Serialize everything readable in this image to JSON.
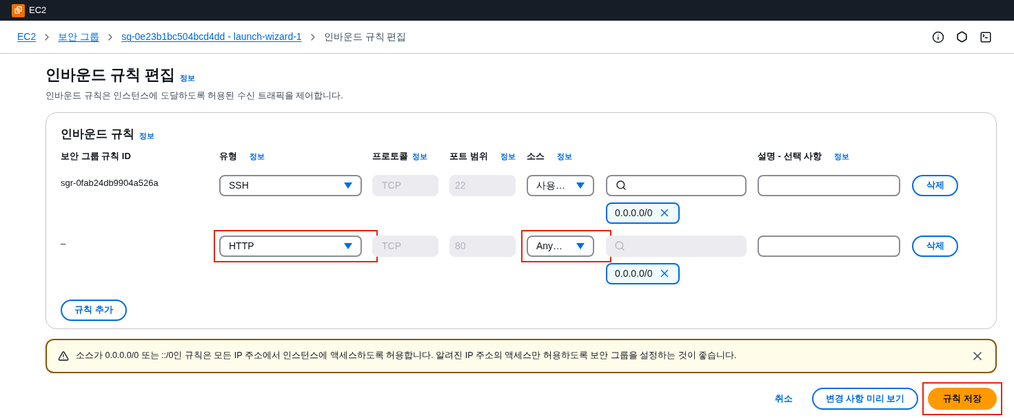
{
  "app": {
    "name": "EC2"
  },
  "breadcrumbs": [
    {
      "label": "EC2",
      "link": true
    },
    {
      "label": "보안 그룹",
      "link": true
    },
    {
      "label": "sg-0e23b1bc504bcd4dd - launch-wizard-1",
      "link": true
    },
    {
      "label": "인바운드 규칙 편집",
      "link": false
    }
  ],
  "page": {
    "title": "인바운드 규칙 편집",
    "info": "정보",
    "description": "인바운드 규칙은 인스턴스에 도달하도록 허용된 수신 트래픽을 제어합니다."
  },
  "panel": {
    "title": "인바운드 규칙",
    "info": "정보",
    "columns": [
      {
        "label": "보안 그룹 규칙 ID"
      },
      {
        "label": "유형",
        "info": "정보"
      },
      {
        "label": "프로토콜",
        "info": "정보"
      },
      {
        "label": "포트 범위",
        "info": "정보"
      },
      {
        "label": "소스",
        "info": "정보"
      },
      {
        "label": "설명 - 선택 사항",
        "info": "정보"
      }
    ],
    "rules": [
      {
        "id": "sgr-0fab24db9904a526a",
        "type": {
          "value": "SSH",
          "highlighted": false
        },
        "protocol": "TCP",
        "port": "22",
        "source": {
          "value": "사용…",
          "highlighted": false
        },
        "search_disabled": false,
        "tokens": [
          "0.0.0.0/0"
        ],
        "delete": "삭제"
      },
      {
        "id": "–",
        "type": {
          "value": "HTTP",
          "highlighted": true
        },
        "protocol": "TCP",
        "port": "80",
        "source": {
          "value": "Any…",
          "highlighted": true
        },
        "search_disabled": true,
        "tokens": [
          "0.0.0.0/0"
        ],
        "delete": "삭제"
      }
    ],
    "add_button": "규칙 추가"
  },
  "warning": {
    "text": "소스가 0.0.0.0/0 또는 ::/0인 규칙은 모든 IP 주소에서 인스턴스에 액세스하도록 허용합니다. 알려진 IP 주소의 액세스만 허용하도록 보안 그룹을 설정하는 것이 좋습니다."
  },
  "footer": {
    "cancel": "취소",
    "preview": "변경 사항 미리 보기",
    "save": {
      "label": "규칙 저장",
      "highlighted": true
    }
  }
}
